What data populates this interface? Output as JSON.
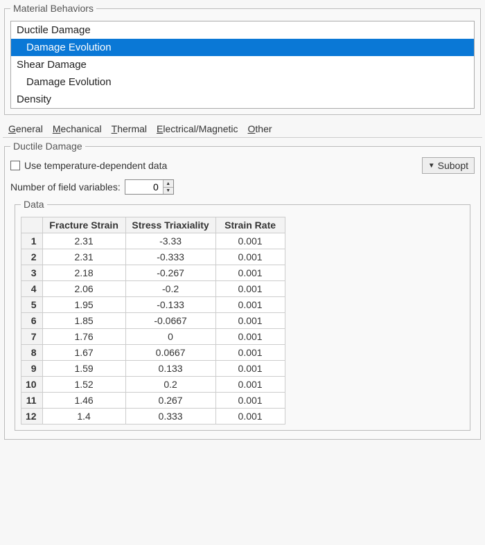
{
  "materialBehaviors": {
    "legend": "Material Behaviors",
    "items": [
      {
        "label": "Ductile Damage",
        "child": false,
        "selected": false
      },
      {
        "label": "Damage Evolution",
        "child": true,
        "selected": true
      },
      {
        "label": "Shear Damage",
        "child": false,
        "selected": false
      },
      {
        "label": "Damage Evolution",
        "child": true,
        "selected": false
      },
      {
        "label": "Density",
        "child": false,
        "selected": false
      }
    ]
  },
  "menuTabs": {
    "items": [
      "General",
      "Mechanical",
      "Thermal",
      "Electrical/Magnetic",
      "Other"
    ]
  },
  "ductileDamage": {
    "legend": "Ductile Damage",
    "useTempLabel": "Use temperature-dependent data",
    "numFieldVarsLabel": "Number of field variables:",
    "numFieldVarsValue": "0",
    "suboptLabel": "Subopt"
  },
  "dataSection": {
    "legend": "Data",
    "headers": [
      "Fracture Strain",
      "Stress Triaxiality",
      "Strain Rate"
    ],
    "rows": [
      {
        "n": "1",
        "fs": "2.31",
        "st": "-3.33",
        "sr": "0.001"
      },
      {
        "n": "2",
        "fs": "2.31",
        "st": "-0.333",
        "sr": "0.001"
      },
      {
        "n": "3",
        "fs": "2.18",
        "st": "-0.267",
        "sr": "0.001"
      },
      {
        "n": "4",
        "fs": "2.06",
        "st": "-0.2",
        "sr": "0.001"
      },
      {
        "n": "5",
        "fs": "1.95",
        "st": "-0.133",
        "sr": "0.001"
      },
      {
        "n": "6",
        "fs": "1.85",
        "st": "-0.0667",
        "sr": "0.001"
      },
      {
        "n": "7",
        "fs": "1.76",
        "st": "0",
        "sr": "0.001"
      },
      {
        "n": "8",
        "fs": "1.67",
        "st": "0.0667",
        "sr": "0.001"
      },
      {
        "n": "9",
        "fs": "1.59",
        "st": "0.133",
        "sr": "0.001"
      },
      {
        "n": "10",
        "fs": "1.52",
        "st": "0.2",
        "sr": "0.001"
      },
      {
        "n": "11",
        "fs": "1.46",
        "st": "0.267",
        "sr": "0.001"
      },
      {
        "n": "12",
        "fs": "1.4",
        "st": "0.333",
        "sr": "0.001"
      }
    ]
  }
}
